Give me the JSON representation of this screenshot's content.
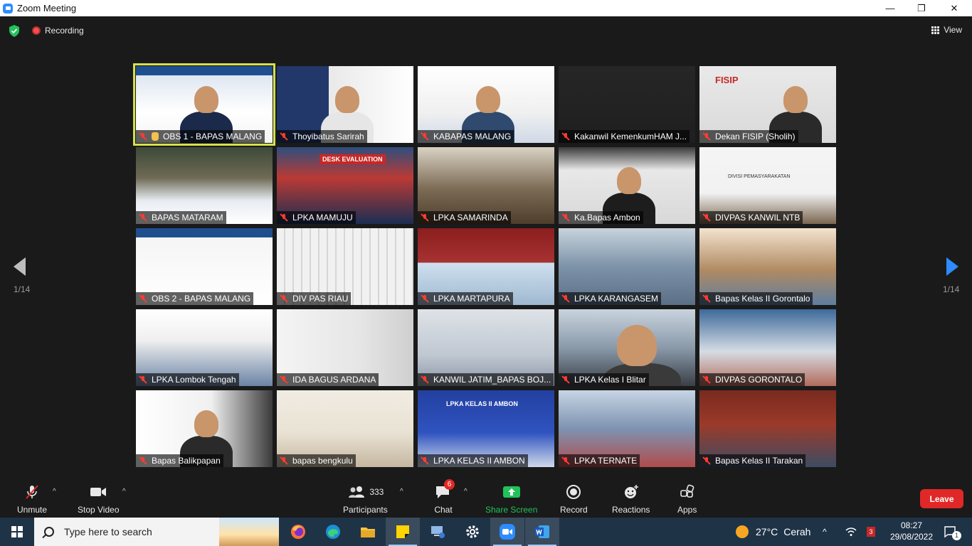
{
  "window": {
    "title": "Zoom Meeting",
    "minimize_glyph": "—",
    "restore_glyph": "❐",
    "close_glyph": "✕"
  },
  "topbar": {
    "recording_label": "Recording",
    "view_label": "View"
  },
  "gallery": {
    "page_left": "1/14",
    "page_right": "1/14",
    "tiles": [
      {
        "name": "OBS 1 - BAPAS MALANG",
        "active": true,
        "hand": true
      },
      {
        "name": "Thoyibatus Sarirah"
      },
      {
        "name": "KABAPAS MALANG"
      },
      {
        "name": "Kakanwil KemenkumHAM J..."
      },
      {
        "name": "Dekan FISIP (Sholih)"
      },
      {
        "name": "BAPAS MATARAM"
      },
      {
        "name": "LPKA MAMUJU"
      },
      {
        "name": "LPKA SAMARINDA"
      },
      {
        "name": "Ka.Bapas Ambon"
      },
      {
        "name": "DIVPAS KANWIL NTB"
      },
      {
        "name": "OBS 2 - BAPAS MALANG"
      },
      {
        "name": "DIV PAS RIAU"
      },
      {
        "name": "LPKA MARTAPURA"
      },
      {
        "name": "LPKA KARANGASEM"
      },
      {
        "name": "Bapas Kelas II Gorontalo"
      },
      {
        "name": "LPKA Lombok Tengah"
      },
      {
        "name": "IDA BAGUS ARDANA"
      },
      {
        "name": "KANWIL JATIM_BAPAS BOJ..."
      },
      {
        "name": "LPKA Kelas I Blitar"
      },
      {
        "name": "DIVPAS GORONTALO"
      },
      {
        "name": "Bapas Balikpapan"
      },
      {
        "name": "bapas bengkulu"
      },
      {
        "name": "LPKA KELAS II AMBON"
      },
      {
        "name": "LPKA TERNATE"
      },
      {
        "name": "Bapas Kelas II Tarakan"
      }
    ],
    "tile_texts": {
      "fisip": "FISIP",
      "desk": "DESK EVALUATION",
      "ambon": "LPKA KELAS II AMBON",
      "divisi": "DIVISI PEMASYARAKATAN"
    }
  },
  "toolbar": {
    "unmute": "Unmute",
    "stop_video": "Stop Video",
    "participants": "Participants",
    "participants_count": "333",
    "chat": "Chat",
    "chat_badge": "6",
    "share_screen": "Share Screen",
    "record": "Record",
    "reactions": "Reactions",
    "apps": "Apps",
    "leave": "Leave",
    "caret": "^"
  },
  "taskbar": {
    "search_placeholder": "Type here to search",
    "weather_temp": "27°C",
    "weather_text": "Cerah",
    "time": "08:27",
    "date": "29/08/2022",
    "notif_count": "1",
    "tray_badge": "3",
    "chevron": "^"
  },
  "colors": {
    "active_speaker": "#d5e04a",
    "share_green": "#22c25b",
    "leave_red": "#e02828",
    "zoom_blue": "#2d8cff",
    "taskbar": "#1f3347"
  }
}
